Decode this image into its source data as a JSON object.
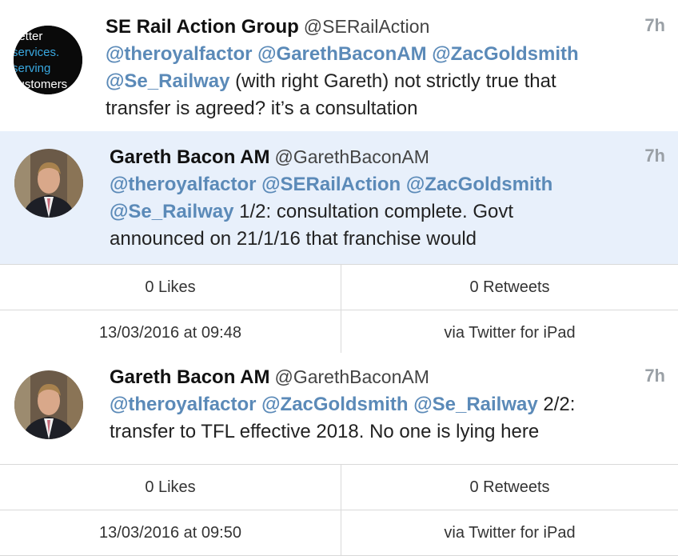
{
  "tweets": [
    {
      "name": "SE Rail Action Group",
      "handle": "@SERailAction",
      "time": "7h",
      "avatar_text": [
        "better",
        "services.",
        "serving",
        "customers"
      ],
      "mentions_line1": [
        "@theroyalfactor",
        "@GarethBaconAM",
        "@ZacGoldsmith"
      ],
      "mention_line2": "@Se_Railway",
      "text_line2": " (with  right Gareth) not strictly true that",
      "text_line3": "transfer is agreed? it’s a consultation"
    },
    {
      "name": "Gareth Bacon AM",
      "handle": "@GarethBaconAM",
      "time": "7h",
      "mentions_line1": [
        "@theroyalfactor",
        "@SERailAction",
        "@ZacGoldsmith"
      ],
      "mention_line2": "@Se_Railway",
      "text_line2": " 1/2: consultation complete. Govt",
      "text_line3": "announced on 21/1/16 that franchise would",
      "likes": "0 Likes",
      "retweets": "0 Retweets",
      "date": "13/03/2016 at 09:48",
      "via": "via Twitter for iPad"
    },
    {
      "name": "Gareth Bacon AM",
      "handle": "@GarethBaconAM",
      "time": "7h",
      "mentions_line1": [
        "@theroyalfactor",
        "@ZacGoldsmith",
        "@Se_Railway"
      ],
      "text_line1": " 2/2:",
      "text_line2": "transfer to TFL effective 2018. No one is lying here",
      "likes": "0 Likes",
      "retweets": "0 Retweets",
      "date": "13/03/2016 at 09:50",
      "via": "via Twitter for iPad"
    }
  ]
}
